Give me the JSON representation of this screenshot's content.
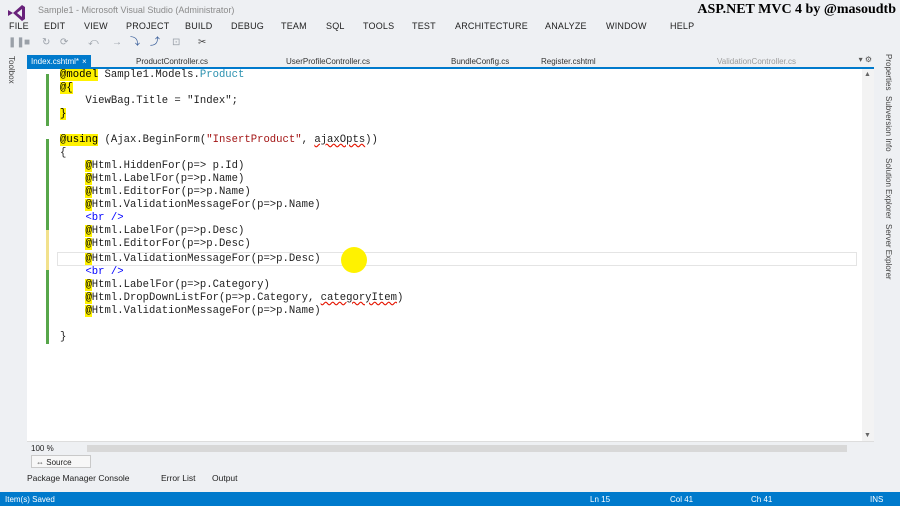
{
  "window": {
    "title": "Sample1 - Microsoft Visual Studio (Administrator)",
    "watermark": "ASP.NET MVC 4 by @masoudtb"
  },
  "menu": [
    "FILE",
    "EDIT",
    "VIEW",
    "PROJECT",
    "BUILD",
    "DEBUG",
    "TEAM",
    "SQL",
    "TOOLS",
    "TEST",
    "ARCHITECTURE",
    "ANALYZE",
    "WINDOW",
    "HELP"
  ],
  "side_panels": {
    "left": "Toolbox",
    "right": [
      "Properties",
      "Subversion Info",
      "Solution Explorer",
      "Server Explorer"
    ]
  },
  "tabs": [
    {
      "label": "Index.cshtml*",
      "state": "active"
    },
    {
      "label": "ProductController.cs",
      "state": "normal"
    },
    {
      "label": "UserProfileController.cs",
      "state": "normal"
    },
    {
      "label": "BundleConfig.cs",
      "state": "normal"
    },
    {
      "label": "Register.cshtml",
      "state": "normal"
    },
    {
      "label": "ValidationController.cs",
      "state": "dim"
    }
  ],
  "code": {
    "l1_kw": "@model",
    "l1_rest": " Sample1.Models.",
    "l1_type": "Product",
    "l2": "@{",
    "l3": "    ViewBag.Title = \"Index\";",
    "l4": "}",
    "l5_kw": "@using",
    "l5_a": " (Ajax.BeginForm(",
    "l5_str": "\"InsertProduct\"",
    "l5_b": ", ",
    "l5_sq": "ajaxOpts",
    "l5_c": "))",
    "l6": "{",
    "l7": "Html.HiddenFor(p=> p.Id)",
    "l8": "Html.LabelFor(p=>p.Name)",
    "l9": "Html.EditorFor(p=>p.Name)",
    "l10": "Html.ValidationMessageFor(p=>p.Name)",
    "l11": "<br />",
    "l12": "Html.LabelFor(p=>p.Desc)",
    "l13": "Html.EditorFor(p=>p.Desc)",
    "l14": "Html.ValidationMessageFor(p=>p.Desc)",
    "l15": "<br />",
    "l16": "Html.LabelFor(p=>p.Category)",
    "l17_a": "Html.DropDownListFor(p=>p.Category, ",
    "l17_sq": "categoryItem",
    "l17_b": ")",
    "l18": "Html.ValidationMessageFor(p=>p.Name)",
    "l19": "}",
    "at": "@"
  },
  "zoom": "100 %",
  "source_button": "Source",
  "bottom_tabs": [
    "Package Manager Console",
    "Error List",
    "Output"
  ],
  "status": {
    "message": "Item(s) Saved",
    "line": "Ln 15",
    "col": "Col 41",
    "ch": "Ch 41",
    "mode": "INS"
  },
  "colors": {
    "accent": "#007acc",
    "razor_highlight": "#fff200",
    "changed_saved": "#57a64a",
    "changed_unsaved": "#f2e18c"
  }
}
